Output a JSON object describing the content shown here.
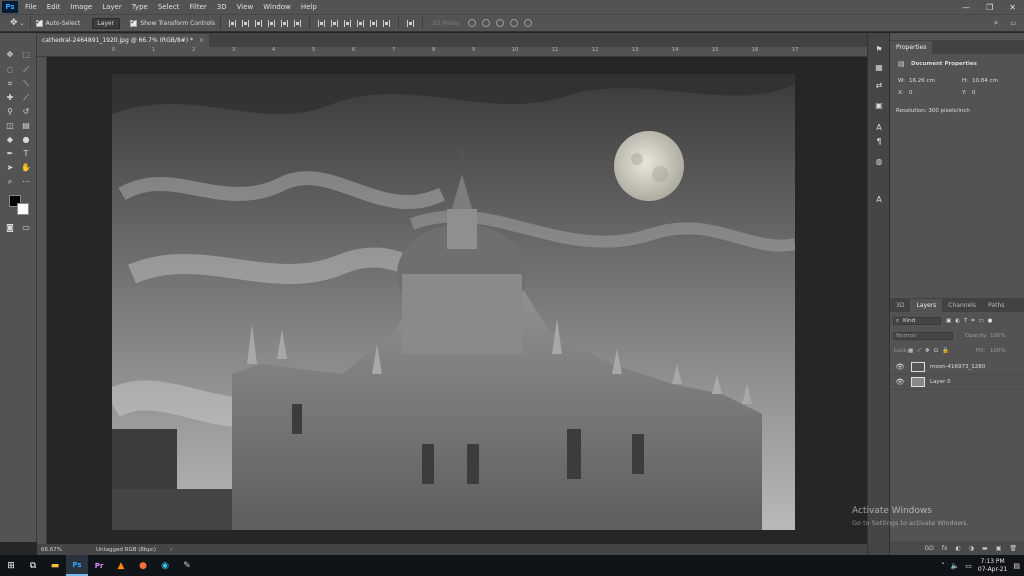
{
  "menubar": {
    "logo": "Ps",
    "items": [
      "File",
      "Edit",
      "Image",
      "Layer",
      "Type",
      "Select",
      "Filter",
      "3D",
      "View",
      "Window",
      "Help"
    ],
    "window_controls": [
      "—",
      "❐",
      "✕"
    ]
  },
  "options": {
    "auto_select_label": "Auto-Select",
    "auto_select_target": "Layer",
    "show_transform_label": "Show Transform Controls",
    "mode_3d_label": "3D Mode:"
  },
  "document": {
    "tab_title": "cathedral-2464891_1920.jpg @ 66.7% (RGB/8#) *",
    "close": "×"
  },
  "ruler_marks": [
    "0",
    "1",
    "2",
    "3",
    "4",
    "5",
    "6",
    "7",
    "8",
    "9",
    "10",
    "11",
    "12",
    "13",
    "14",
    "15",
    "16",
    "17"
  ],
  "status": {
    "zoom": "66.67%",
    "profile": "Untagged RGB (8bpc)",
    "arrow": "›"
  },
  "properties": {
    "tab_label": "Properties",
    "section_title": "Document Properties",
    "width_label": "W:",
    "width_value": "16.26 cm",
    "height_label": "H:",
    "height_value": "10.84 cm",
    "x_label": "X:",
    "x_value": "0",
    "y_label": "Y:",
    "y_value": "0",
    "resolution": "Resolution: 300 pixels/inch"
  },
  "layers_panel": {
    "tabs": [
      "3D",
      "Layers",
      "Channels",
      "Paths"
    ],
    "active_tab": "Layers",
    "kind_label": "Kind",
    "blend_mode": "Normal",
    "opacity_label": "Opacity:",
    "opacity_value": "100%",
    "lock_label": "Lock:",
    "fill_label": "Fill:",
    "fill_value": "100%",
    "layers": [
      {
        "name": "moon-416973_1280"
      },
      {
        "name": "Layer 0"
      }
    ],
    "footer_icons": [
      "GO",
      "fx",
      "◐",
      "◑",
      "▬",
      "▣",
      "🗑"
    ]
  },
  "watermark": {
    "title": "Activate Windows",
    "subtitle": "Go to Settings to activate Windows."
  },
  "taskbar": {
    "apps": [
      "windows-start",
      "task-view",
      "file-explorer",
      "photoshop",
      "premiere",
      "vlc",
      "firefox",
      "edge",
      "other-app"
    ],
    "clock_time": "7:13 PM",
    "clock_date": "07-Apr-21"
  },
  "colors": {
    "accent": "#31a8ff",
    "panel": "#535353",
    "dark": "#262626"
  }
}
